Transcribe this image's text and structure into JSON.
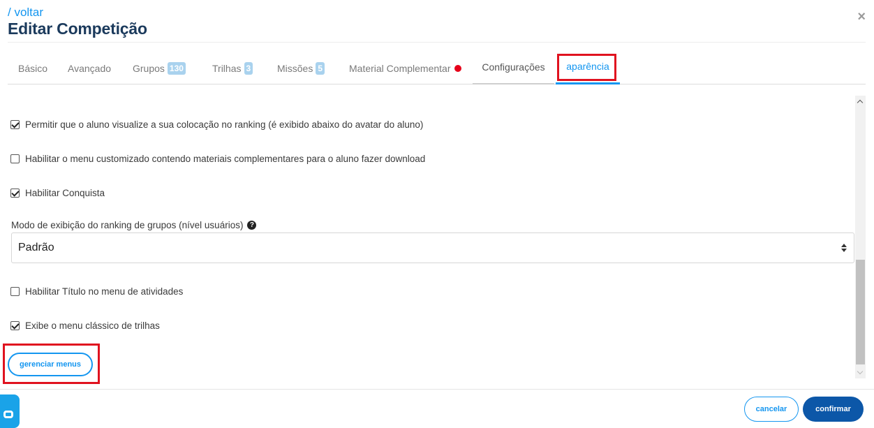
{
  "header": {
    "back_label": "/ voltar",
    "title": "Editar Competição",
    "close_label": "×"
  },
  "tabs": [
    {
      "label": "Básico"
    },
    {
      "label": "Avançado"
    },
    {
      "label": "Grupos",
      "badge": "130"
    },
    {
      "label": "Trilhas",
      "badge": "3"
    },
    {
      "label": "Missões",
      "badge": "5"
    },
    {
      "label": "Material Complementar",
      "indicator": "red-dot"
    },
    {
      "label": "Configurações"
    },
    {
      "label": "aparência",
      "active": true
    }
  ],
  "settings": {
    "ranking_position": {
      "label": "Permitir que o aluno visualize a sua colocação no ranking (é exibido abaixo do avatar do aluno)",
      "checked": true
    },
    "custom_menu": {
      "label": "Habilitar o menu customizado contendo materiais complementares para o aluno fazer download",
      "checked": false
    },
    "achievement": {
      "label": "Habilitar Conquista",
      "checked": true
    },
    "group_ranking_mode": {
      "label": "Modo de exibição do ranking de grupos (nível usuários)",
      "help_icon": "question-circle-icon",
      "value": "Padrão"
    },
    "activity_menu_title": {
      "label": "Habilitar Título no menu de atividades",
      "checked": false
    },
    "classic_menu": {
      "label": "Exibe o menu clássico de trilhas",
      "checked": true
    }
  },
  "buttons": {
    "manage_menus": "gerenciar menus",
    "cancel": "cancelar",
    "confirm": "confirmar"
  },
  "colors": {
    "accent": "#1496f0",
    "title": "#1b3a5c",
    "confirm_bg": "#0c57a8",
    "badge_bg": "#a9d2ee",
    "highlight_box": "#e0121f"
  }
}
